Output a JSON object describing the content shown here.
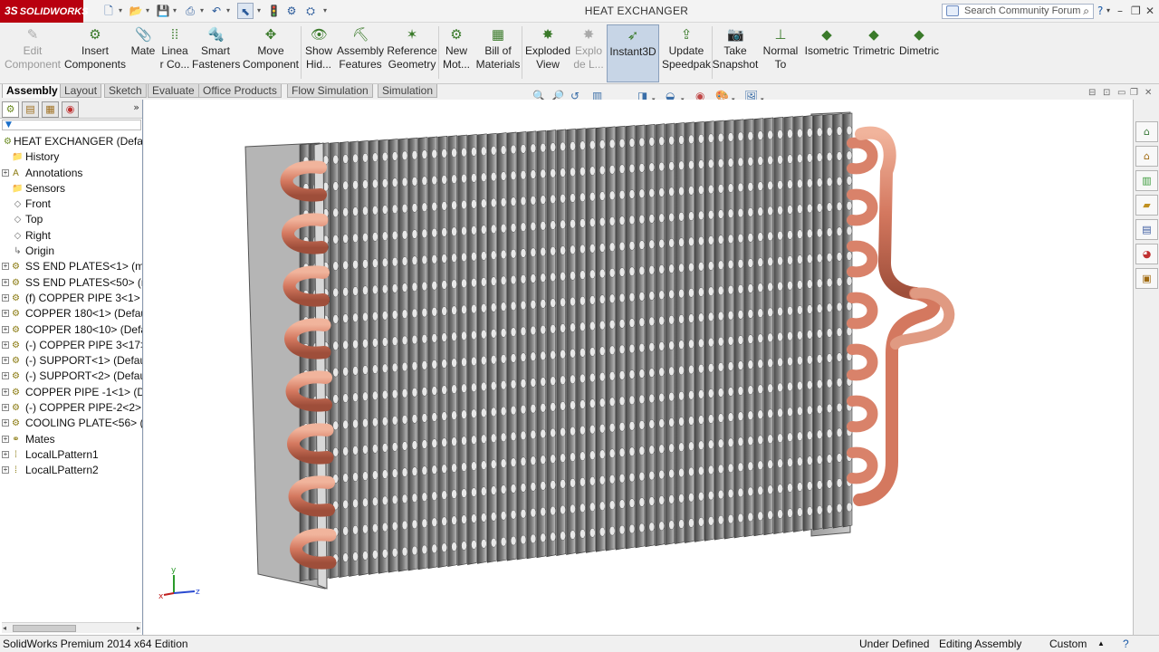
{
  "app": {
    "brand": "SOLIDWORKS",
    "document_title": "HEAT EXCHANGER",
    "search_placeholder": "Search Community Forum",
    "help_label": "?",
    "window_controls": {
      "minimize": "–",
      "restore": "❐",
      "close": "✕"
    }
  },
  "quick_access": {
    "new": "🗋",
    "open": "📂",
    "save": "💾",
    "print": "⎙",
    "undo": "↶",
    "select": "⬉",
    "rebuild": "🚦",
    "file_props": "⚙",
    "options": "⛭",
    "dropdown": "▾"
  },
  "ribbon": [
    {
      "id": "edit-component",
      "label": "Edit\nComponent",
      "icon": "✎",
      "disabled": true
    },
    {
      "id": "insert-components",
      "label": "Insert\nComponents",
      "icon": "⚙",
      "disabled": false
    },
    {
      "id": "mate",
      "label": "Mate",
      "icon": "📎",
      "disabled": false
    },
    {
      "id": "linear-component-pattern",
      "label": "Linea\nr Co...",
      "icon": "⁞⁞",
      "disabled": false
    },
    {
      "id": "smart-fasteners",
      "label": "Smart\nFasteners",
      "icon": "🔩",
      "disabled": false
    },
    {
      "id": "move-component",
      "label": "Move\nComponent",
      "icon": "✥",
      "disabled": false
    },
    {
      "id": "show-hidden-components",
      "label": "Show\nHid...",
      "icon": "👁",
      "disabled": false
    },
    {
      "id": "assembly-features",
      "label": "Assembly\nFeatures",
      "icon": "⛏",
      "disabled": false
    },
    {
      "id": "reference-geometry",
      "label": "Reference\nGeometry",
      "icon": "✶",
      "disabled": false
    },
    {
      "id": "new-motion-study",
      "label": "New\nMot...",
      "icon": "⚙",
      "disabled": false
    },
    {
      "id": "bill-of-materials",
      "label": "Bill of\nMaterials",
      "icon": "▦",
      "disabled": false
    },
    {
      "id": "exploded-view",
      "label": "Exploded\nView",
      "icon": "✸",
      "disabled": false
    },
    {
      "id": "explode-line-sketch",
      "label": "Explo\nde L...",
      "icon": "✸",
      "disabled": true
    },
    {
      "id": "instant3d",
      "label": "Instant3D",
      "icon": "➶",
      "disabled": false,
      "active": true
    },
    {
      "id": "update-speedpak",
      "label": "Update\nSpeedpak",
      "icon": "⇪",
      "disabled": false
    },
    {
      "id": "take-snapshot",
      "label": "Take\nSnapshot",
      "icon": "📷",
      "disabled": false
    },
    {
      "id": "normal-to",
      "label": "Normal\nTo",
      "icon": "⊥",
      "disabled": false
    },
    {
      "id": "isometric",
      "label": "Isometric",
      "icon": "◆",
      "disabled": false
    },
    {
      "id": "trimetric",
      "label": "Trimetric",
      "icon": "◆",
      "disabled": false
    },
    {
      "id": "dimetric",
      "label": "Dimetric",
      "icon": "◆",
      "disabled": false
    }
  ],
  "tabs": [
    "Assembly",
    "Layout",
    "Sketch",
    "Evaluate",
    "Office Products",
    "Flow Simulation",
    "Simulation"
  ],
  "heads_up": {
    "zoom_fit": "🔍",
    "zoom_area": "🔎",
    "previous_view": "↺",
    "section_view": "▥",
    "view_orientation": "◨",
    "display_style": "◒",
    "hide_show": "◉",
    "edit_appearance": "🎨",
    "apply_scene": "🖼",
    "dropdown": "▾"
  },
  "feature_manager": {
    "expand_label": "»",
    "filter_label": "▼",
    "root": "HEAT EXCHANGER  (Default<Display State-1>)",
    "items": [
      {
        "label": "History",
        "type": "child",
        "icon": "📁"
      },
      {
        "label": "Annotations",
        "type": "sub",
        "icon": "A"
      },
      {
        "label": "Sensors",
        "type": "child",
        "icon": "📁"
      },
      {
        "label": "Front",
        "type": "child",
        "icon": "◇"
      },
      {
        "label": "Top",
        "type": "child",
        "icon": "◇"
      },
      {
        "label": "Right",
        "type": "child",
        "icon": "◇"
      },
      {
        "label": "Origin",
        "type": "child",
        "icon": "↳"
      },
      {
        "label": "SS END PLATES<1> (mo",
        "type": "sub",
        "icon": "⚙"
      },
      {
        "label": "SS END PLATES<50> (m",
        "type": "sub",
        "icon": "⚙"
      },
      {
        "label": "(f) COPPER PIPE 3<1> (D",
        "type": "sub",
        "icon": "⚙"
      },
      {
        "label": "COPPER 180<1> (Defaul",
        "type": "sub",
        "icon": "⚙"
      },
      {
        "label": "COPPER 180<10> (Defa",
        "type": "sub",
        "icon": "⚙"
      },
      {
        "label": "(-) COPPER PIPE 3<17> (",
        "type": "sub",
        "icon": "⚙"
      },
      {
        "label": "(-) SUPPORT<1> (Defaul",
        "type": "sub",
        "icon": "⚙"
      },
      {
        "label": "(-) SUPPORT<2> (Defaul",
        "type": "sub",
        "icon": "⚙"
      },
      {
        "label": "COPPER PIPE -1<1> (De",
        "type": "sub",
        "icon": "⚙"
      },
      {
        "label": "(-) COPPER PIPE-2<2> (D",
        "type": "sub",
        "icon": "⚙"
      },
      {
        "label": "COOLING PLATE<56> (D",
        "type": "sub",
        "icon": "⚙"
      },
      {
        "label": "Mates",
        "type": "sub",
        "icon": "⚭"
      },
      {
        "label": "LocalLPattern1",
        "type": "sub",
        "icon": "⁞"
      },
      {
        "label": "LocalLPattern2",
        "type": "sub",
        "icon": "⁞"
      }
    ]
  },
  "triad": {
    "x": "x",
    "y": "y",
    "z": "z"
  },
  "task_pane_icons": [
    "resources-icon",
    "design-library-icon",
    "file-explorer-icon",
    "folder-icon",
    "view-palette-icon",
    "appearances-icon",
    "custom-properties-icon"
  ],
  "status": {
    "edition": "SolidWorks Premium 2014 x64 Edition",
    "state": "Under Defined",
    "mode": "Editing Assembly",
    "units": "Custom",
    "units_caret": "▲",
    "help_icon": "?"
  },
  "colors": {
    "brand_red": "#b8000f",
    "copper": "#d9826a",
    "fin_dark": "#5b5b5b",
    "fin_light": "#b8b8b8",
    "plate": "#a8a8a8",
    "selection_blue": "#1a6ec9"
  }
}
